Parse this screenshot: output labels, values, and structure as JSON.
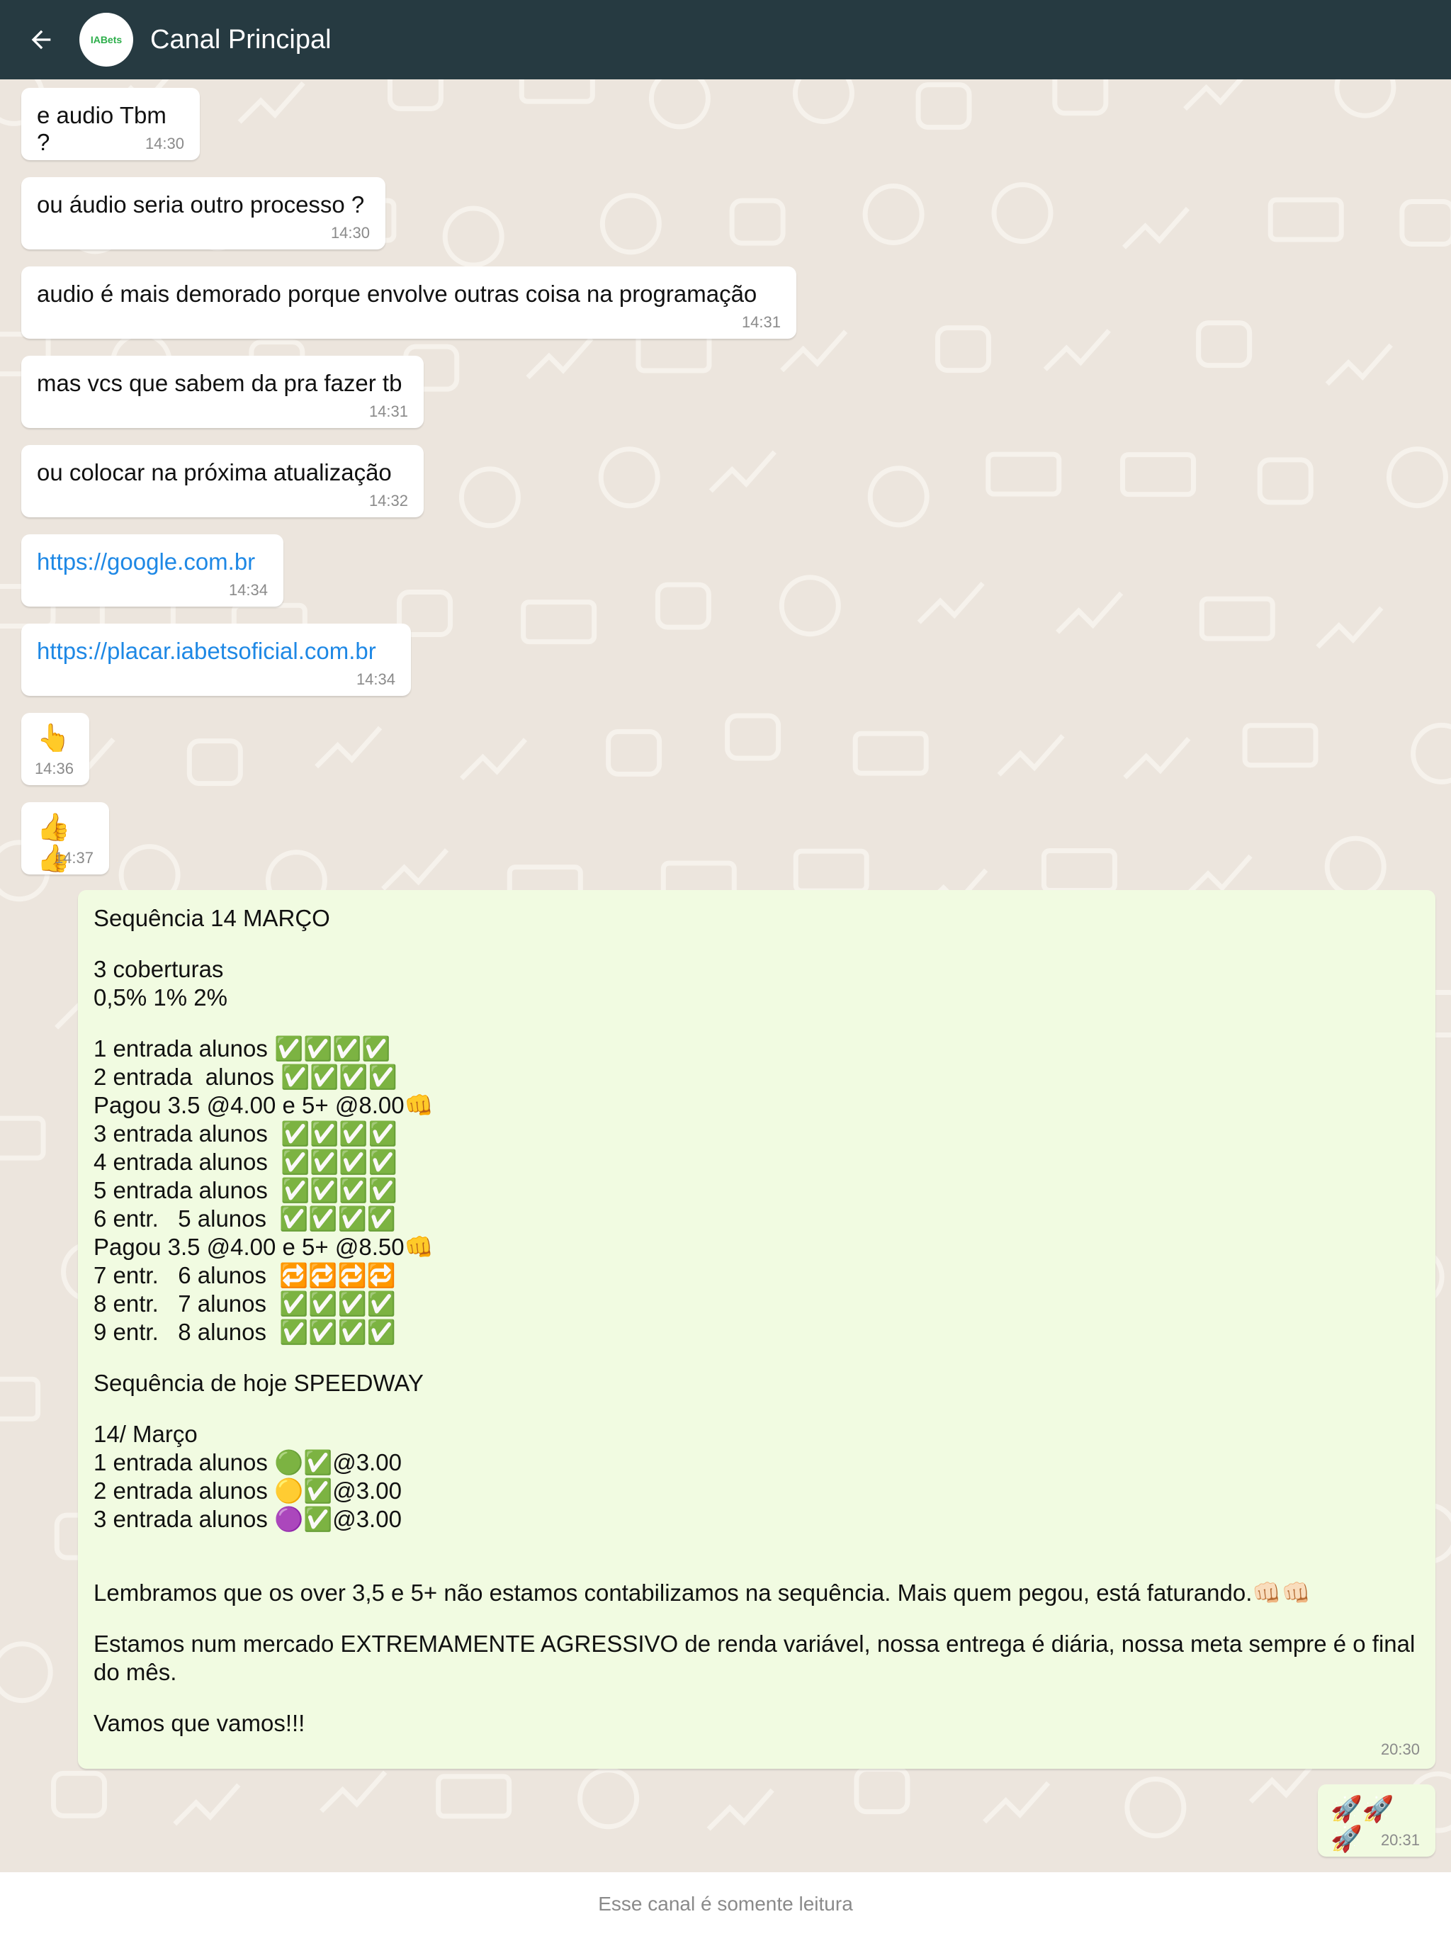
{
  "header": {
    "title": "Canal Principal",
    "avatar_logo_text": "IABets"
  },
  "messages": [
    {
      "text": "e audio Tbm ?",
      "time": "14:30"
    },
    {
      "text": "ou áudio seria outro processo ?",
      "time": "14:30"
    },
    {
      "text": "audio é mais demorado porque envolve outras coisa na programação",
      "time": "14:31"
    },
    {
      "text": "mas vcs que sabem da pra fazer tb",
      "time": "14:31"
    },
    {
      "text": "ou colocar na próxima atualização",
      "time": "14:32"
    },
    {
      "text": "https://google.com.br",
      "time": "14:34"
    },
    {
      "text": "https://placar.iabetsoficial.com.br",
      "time": "14:34"
    },
    {
      "text": "👆",
      "time": "14:36"
    },
    {
      "text": "👍👍",
      "time": "14:37"
    }
  ],
  "long_message": {
    "title": "Sequência 14 MARÇO",
    "cover_1": "3 coberturas",
    "cover_2": "0,5% 1% 2%",
    "seq": [
      "1 entrada alunos ✅✅✅✅",
      "2 entrada  alunos ✅✅✅✅",
      "Pagou 3.5 @4.00 e 5+ @8.00👊",
      "3 entrada alunos  ✅✅✅✅",
      "4 entrada alunos  ✅✅✅✅",
      "5 entrada alunos  ✅✅✅✅",
      "6 entr.   5 alunos  ✅✅✅✅",
      "Pagou 3.5 @4.00 e 5+ @8.50👊",
      "7 entr.   6 alunos  🔁🔁🔁🔁",
      "8 entr.   7 alunos  ✅✅✅✅",
      "9 entr.   8 alunos  ✅✅✅✅"
    ],
    "speedway_title": "Sequência de hoje SPEEDWAY",
    "speedway_date": "14/ Março",
    "speedway": [
      "1 entrada alunos 🟢✅@3.00",
      "2 entrada alunos 🟡✅@3.00",
      "3 entrada alunos 🟣✅@3.00"
    ],
    "para1": "Lembramos que os over 3,5 e 5+ não estamos contabilizamos na sequência. Mais quem pegou, está faturando.👊🏻👊🏻",
    "para2": "Estamos num mercado EXTREMAMENTE AGRESSIVO de renda variável, nossa entrega é diária, nossa meta sempre é o final do mês.",
    "para3": "Vamos que vamos!!!",
    "time": "20:30"
  },
  "rocket_message": {
    "text": "🚀🚀🚀",
    "time": "20:31"
  },
  "footer": {
    "text": "Esse canal é somente leitura"
  },
  "colors": {
    "header_bg": "#263a41",
    "chat_bg": "#ece5dd",
    "incoming_bubble": "#ffffff",
    "outgoing_bubble": "#f1fbe1",
    "link": "#1e88e5",
    "brand_green": "#2cae4a"
  }
}
